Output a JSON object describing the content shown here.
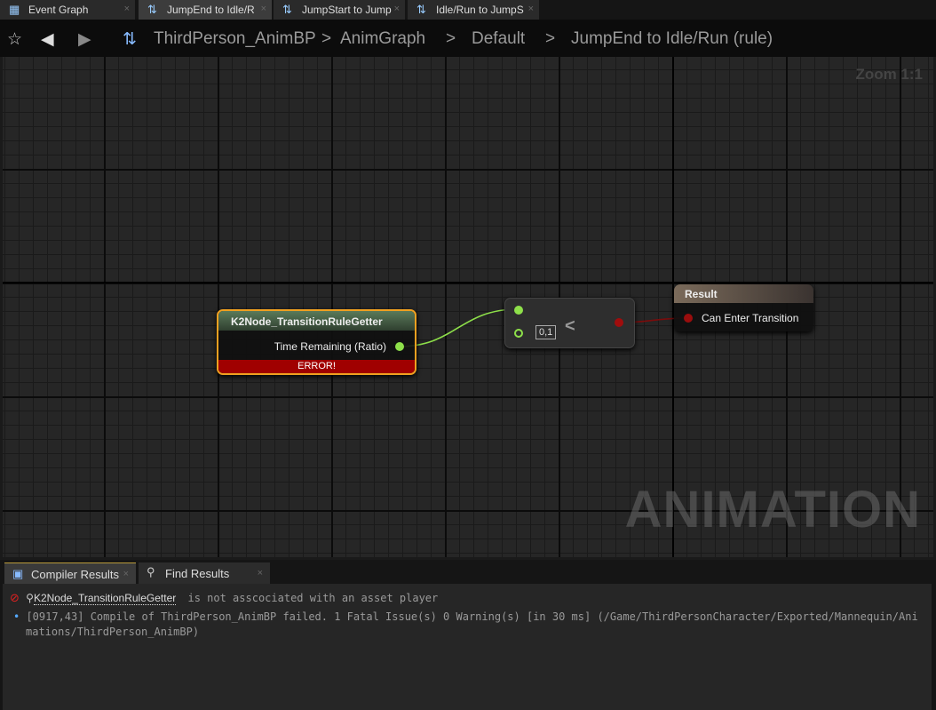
{
  "tabs": [
    {
      "label": "Event Graph",
      "icon": "graph-icon",
      "active": false
    },
    {
      "label": "JumpEnd to Idle/R",
      "icon": "transition-icon",
      "active": true
    },
    {
      "label": "JumpStart to Jump",
      "icon": "transition-icon",
      "active": false
    },
    {
      "label": "Idle/Run to JumpS",
      "icon": "transition-icon",
      "active": false
    }
  ],
  "breadcrumb": {
    "items": [
      "ThirdPerson_AnimBP",
      "AnimGraph",
      "Default",
      "JumpEnd to Idle/Run (rule)"
    ],
    "separator": ">"
  },
  "zoom_label": "Zoom 1:1",
  "watermark": "ANIMATION",
  "nodes": {
    "getter": {
      "title": "K2Node_TransitionRuleGetter",
      "pin": "Time Remaining (Ratio)",
      "error": "ERROR!"
    },
    "compare": {
      "operator": "<",
      "default_value": "0,1"
    },
    "result": {
      "title": "Result",
      "pin": "Can Enter Transition"
    }
  },
  "bottom_tabs": [
    {
      "label": "Compiler Results"
    },
    {
      "label": "Find Results"
    }
  ],
  "messages": [
    {
      "type": "error",
      "link": "K2Node_TransitionRuleGetter",
      "text": "is not asscociated with an asset player"
    },
    {
      "type": "info",
      "text": "[0917,43] Compile of ThirdPerson_AnimBP failed. 1 Fatal Issue(s) 0 Warning(s) [in 30 ms] (/Game/ThirdPersonCharacter/Exported/Mannequin/Animations/ThirdPerson_AnimBP)"
    }
  ],
  "colors": {
    "float_pin": "#8ee04a",
    "bool_pin": "#9a0d0d",
    "error": "#a00000",
    "selected": "#f0a020"
  }
}
